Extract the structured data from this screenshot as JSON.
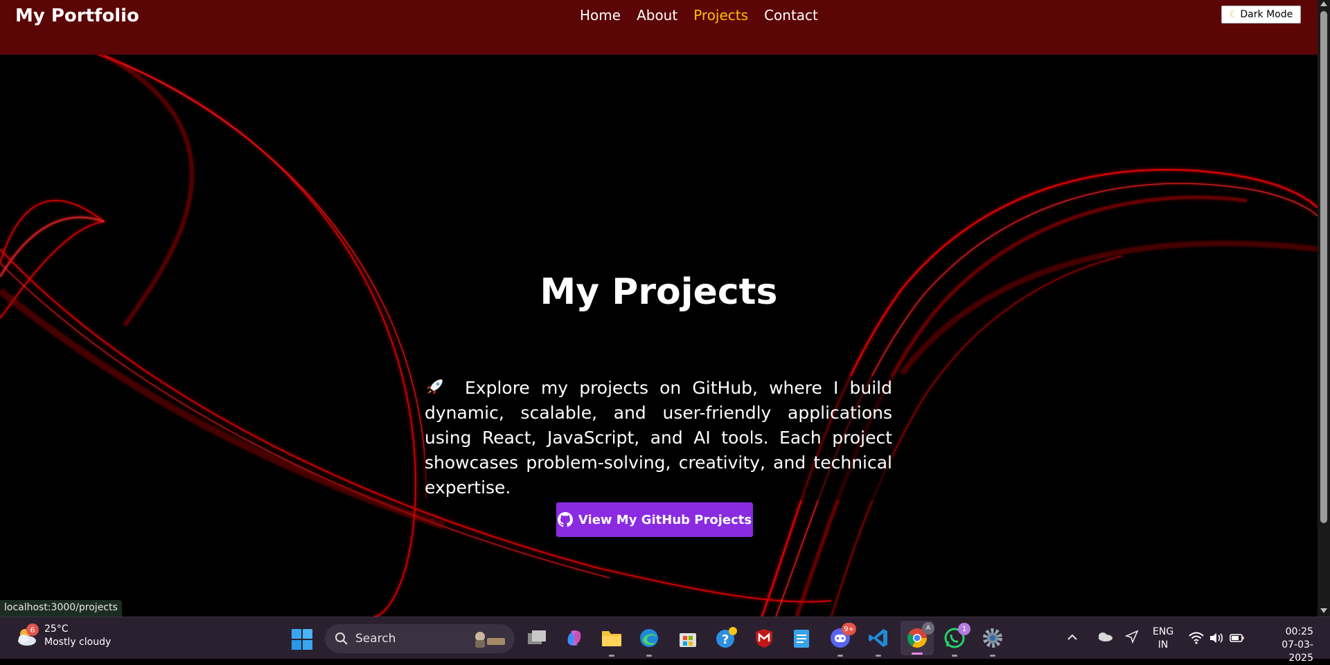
{
  "navbar": {
    "brand": "My Portfolio",
    "links": [
      {
        "label": "Home",
        "active": false
      },
      {
        "label": "About",
        "active": false
      },
      {
        "label": "Projects",
        "active": true
      },
      {
        "label": "Contact",
        "active": false
      }
    ],
    "dark_mode_label": "Dark Mode",
    "dark_mode_icon": "moon-icon",
    "bg_color": "#5c0506",
    "active_color": "#ffc107"
  },
  "hero": {
    "title": "My Projects",
    "description_icon": "rocket-icon",
    "description": "Explore my projects on GitHub, where I build dynamic, scalable, and user-friendly applications using React, JavaScript, and AI tools. Each project showcases problem-solving, creativity, and technical expertise.",
    "cta_label": "View My GitHub Projects",
    "cta_icon": "github-icon",
    "cta_color": "#8a2be2"
  },
  "status_bar": {
    "url": "localhost:3000/projects"
  },
  "taskbar": {
    "weather": {
      "badge": "6",
      "temp": "25°C",
      "condition": "Mostly cloudy"
    },
    "search_placeholder": "Search",
    "apps": [
      {
        "name": "task-view-icon"
      },
      {
        "name": "copilot-icon"
      },
      {
        "name": "file-explorer-icon"
      },
      {
        "name": "edge-icon"
      },
      {
        "name": "microsoft-store-icon"
      },
      {
        "name": "get-help-icon"
      },
      {
        "name": "mcafee-icon"
      },
      {
        "name": "notepad-icon"
      },
      {
        "name": "discord-icon",
        "badge": "9+"
      },
      {
        "name": "vscode-icon"
      },
      {
        "name": "chrome-icon"
      },
      {
        "name": "whatsapp-icon",
        "badge": "1"
      },
      {
        "name": "settings-icon"
      }
    ],
    "language": {
      "line1": "ENG",
      "line2": "IN"
    },
    "clock": {
      "time": "00:25",
      "date": "07-03-2025"
    }
  }
}
